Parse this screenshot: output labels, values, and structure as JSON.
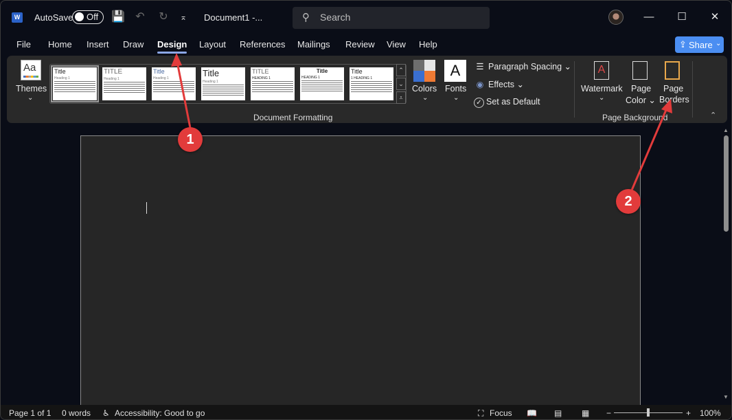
{
  "titlebar": {
    "app_icon": "W",
    "autosave_label": "AutoSave",
    "autosave_state": "Off",
    "save_icon": "💾",
    "undo_icon": "↶",
    "redo_icon": "↻",
    "qat_more_icon": "⌅",
    "document_title": "Document1  -...",
    "search_placeholder": "Search",
    "search_icon": "⚲",
    "minimize_icon": "—",
    "maximize_icon": "☐",
    "close_icon": "✕"
  },
  "tabs": [
    {
      "label": "File"
    },
    {
      "label": "Home"
    },
    {
      "label": "Insert"
    },
    {
      "label": "Draw"
    },
    {
      "label": "Design",
      "active": true
    },
    {
      "label": "Layout"
    },
    {
      "label": "References"
    },
    {
      "label": "Mailings"
    },
    {
      "label": "Review"
    },
    {
      "label": "View"
    },
    {
      "label": "Help"
    }
  ],
  "share": {
    "label": "Share",
    "icon": "⇪",
    "chevron": "⌄"
  },
  "ribbon": {
    "themes": {
      "label": "Themes",
      "icon_text": "Aa",
      "chevron": "⌄"
    },
    "style_gallery": [
      {
        "title": "Title",
        "heading": "Heading 1"
      },
      {
        "title": "TITLE",
        "heading": "Heading 1"
      },
      {
        "title": "Title",
        "heading": "Heading 1"
      },
      {
        "title": "Title",
        "heading": "Heading 1"
      },
      {
        "title": "TITLE",
        "heading": "HEADING 1"
      },
      {
        "title": "Title",
        "heading": "HEADING 1"
      },
      {
        "title": "Title",
        "heading": "1   HEADING 1"
      }
    ],
    "gallery_up": "⌃",
    "gallery_down": "⌄",
    "gallery_more": "⩡",
    "colors": {
      "label": "Colors",
      "chevron": "⌄",
      "swatches": [
        "#6e6e6e",
        "#e6e6e6",
        "#3a6fd0",
        "#ee7a34"
      ]
    },
    "fonts": {
      "label": "Fonts",
      "icon_text": "A",
      "chevron": "⌄"
    },
    "paragraph_spacing": {
      "label": "Paragraph Spacing ⌄",
      "icon": "☰"
    },
    "effects": {
      "label": "Effects ⌄",
      "icon": "◉"
    },
    "set_as_default": {
      "label": "Set as Default",
      "icon": "✓"
    },
    "document_formatting_label": "Document Formatting",
    "watermark": {
      "label": "Watermark",
      "chevron": "⌄",
      "icon": "A"
    },
    "page_color": {
      "label_line1": "Page",
      "label_line2": "Color ⌄"
    },
    "page_borders": {
      "label_line1": "Page",
      "label_line2": "Borders"
    },
    "page_background_label": "Page Background",
    "collapse_icon": "⌃"
  },
  "annotations": [
    {
      "number": "1"
    },
    {
      "number": "2"
    }
  ],
  "statusbar": {
    "page": "Page 1 of 1",
    "words": "0 words",
    "accessibility": "Accessibility: Good to go",
    "accessibility_icon": "♿",
    "focus": "Focus",
    "focus_icon": "⛶",
    "read_mode_icon": "📖",
    "print_layout_icon": "▤",
    "web_layout_icon": "▦",
    "zoom_out": "−",
    "zoom_in": "+",
    "zoom_level": "100%",
    "zoom_fraction": 0.5
  }
}
